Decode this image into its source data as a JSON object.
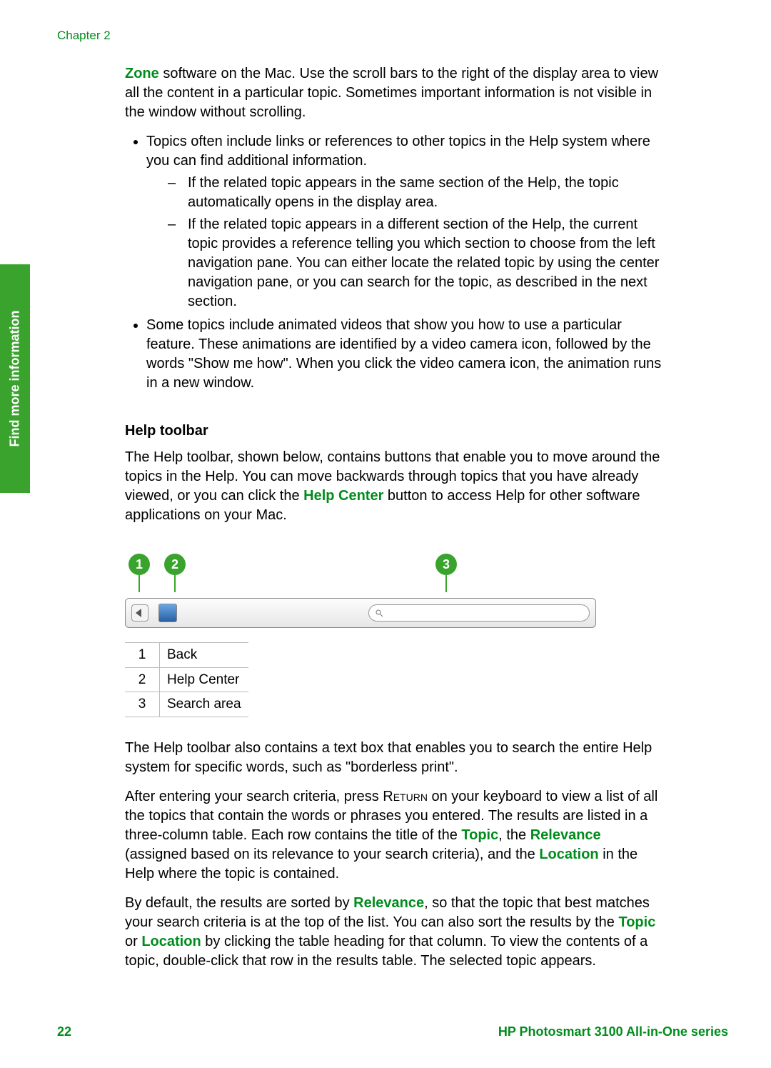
{
  "chapter_label": "Chapter 2",
  "side_tab": "Find more information",
  "intro": {
    "zone": "Zone",
    "rest": " software on the Mac. Use the scroll bars to the right of the display area to view all the content in a particular topic. Sometimes important information is not visible in the window without scrolling."
  },
  "bullet_topics": "Topics often include links or references to other topics in the Help system where you can find additional information.",
  "sub_a": "If the related topic appears in the same section of the Help, the topic automatically opens in the display area.",
  "sub_b": "If the related topic appears in a different section of the Help, the current topic provides a reference telling you which section to choose from the left navigation pane. You can either locate the related topic by using the center navigation pane, or you can search for the topic, as described in the next section.",
  "bullet_video": "Some topics include animated videos that show you how to use a particular feature. These animations are identified by a video camera icon, followed by the words \"Show me how\". When you click the video camera icon, the animation runs in a new window.",
  "help_toolbar_heading": "Help toolbar",
  "help_toolbar_para_pre": "The Help toolbar, shown below, contains buttons that enable you to move around the topics in the Help. You can move backwards through topics that you have already viewed, or you can click the ",
  "help_center": "Help Center",
  "help_toolbar_para_post": " button to access Help for other software applications on your Mac.",
  "callouts": {
    "c1": "1",
    "c2": "2",
    "c3": "3"
  },
  "legend": [
    {
      "n": "1",
      "label": "Back"
    },
    {
      "n": "2",
      "label": "Help Center"
    },
    {
      "n": "3",
      "label": "Search area"
    }
  ],
  "para_textbox": "The Help toolbar also contains a text box that enables you to search the entire Help system for specific words, such as \"borderless print\".",
  "para_after_pre": "After entering your search criteria, press ",
  "return_key": "Return",
  "para_after_mid": " on your keyboard to view a list of all the topics that contain the words or phrases you entered. The results are listed in a three-column table. Each row contains the title of the ",
  "topic": "Topic",
  "comma_the": ", the ",
  "relevance": "Relevance",
  "para_after_mid2": " (assigned based on its relevance to your search criteria), and the ",
  "location": "Location",
  "para_after_end": " in the Help where the topic is contained.",
  "para_sort_pre": "By default, the results are sorted by ",
  "para_sort_mid": ", so that the topic that best matches your search criteria is at the top of the list. You can also sort the results by the ",
  "or_sep": " or ",
  "para_sort_end": " by clicking the table heading for that column. To view the contents of a topic, double-click that row in the results table. The selected topic appears.",
  "footer": {
    "page": "22",
    "product": "HP Photosmart 3100 All-in-One series"
  }
}
